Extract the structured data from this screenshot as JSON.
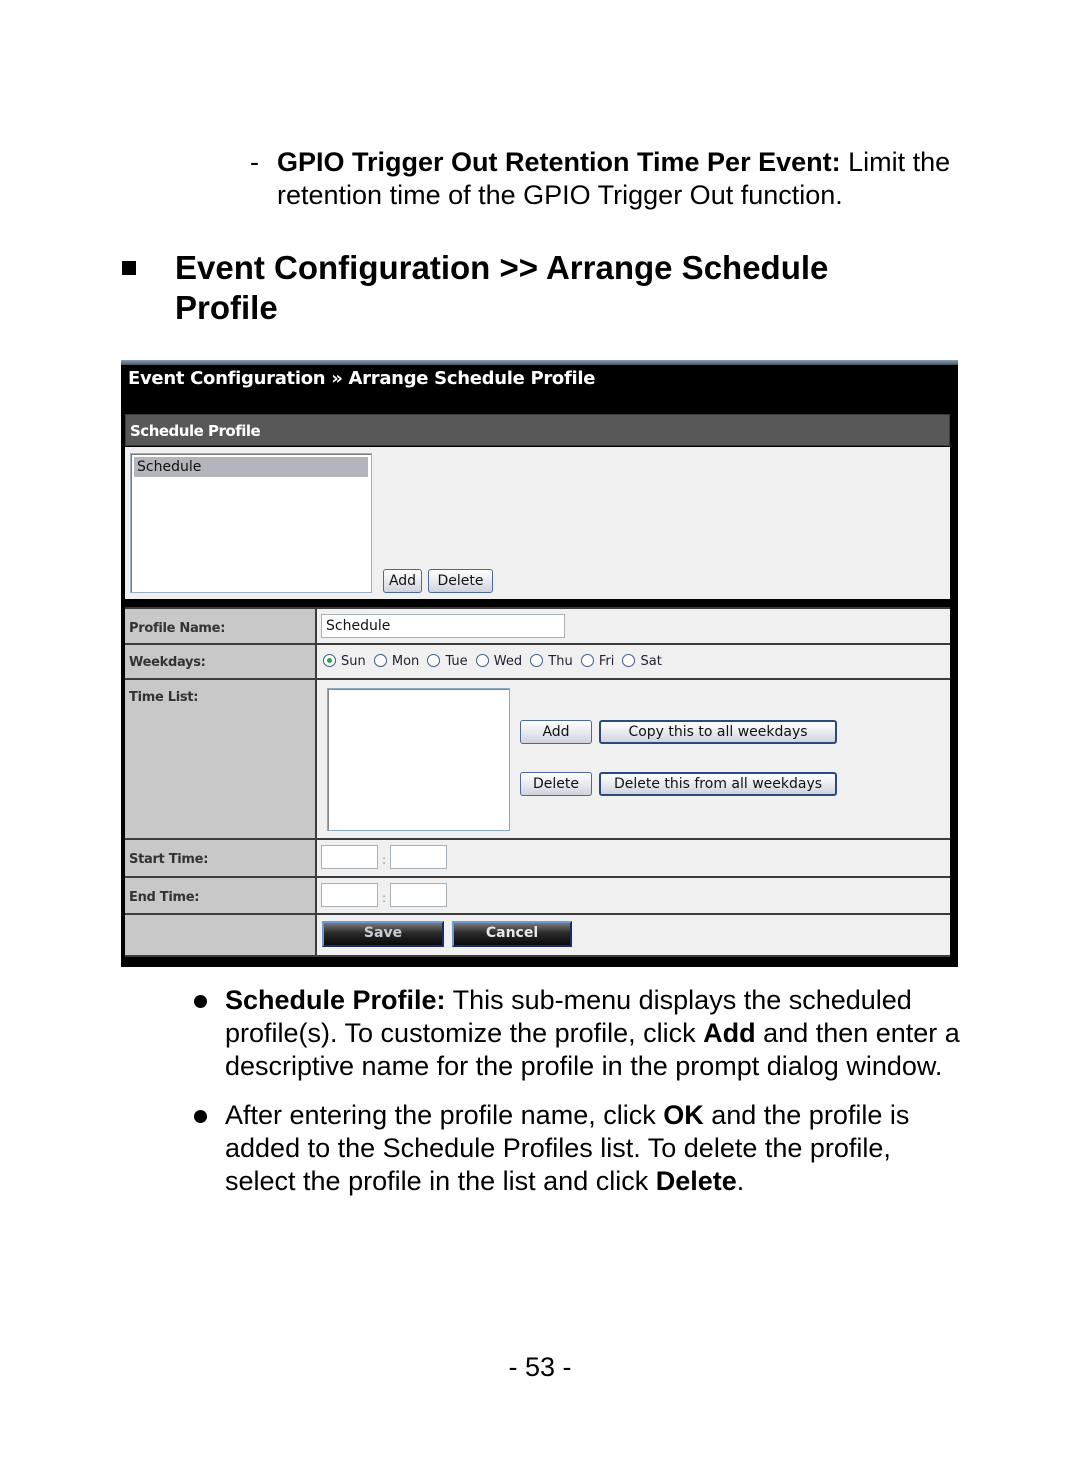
{
  "intro": {
    "dash": "-",
    "bold": "GPIO Trigger Out Retention Time Per Event:",
    "text": " Limit the retention time of the GPIO Trigger Out function."
  },
  "heading": "Event Configuration >> Arrange Schedule Profile",
  "ui": {
    "title": "Event Configuration » Arrange Schedule Profile",
    "section_title": "Schedule Profile",
    "profile_list": [
      "Schedule"
    ],
    "add_label": "Add",
    "delete_label": "Delete",
    "form": {
      "profile_name_label": "Profile Name:",
      "profile_name_value": "Schedule",
      "weekdays_label": "Weekdays:",
      "weekdays": [
        {
          "label": "Sun",
          "selected": true
        },
        {
          "label": "Mon",
          "selected": false
        },
        {
          "label": "Tue",
          "selected": false
        },
        {
          "label": "Wed",
          "selected": false
        },
        {
          "label": "Thu",
          "selected": false
        },
        {
          "label": "Fri",
          "selected": false
        },
        {
          "label": "Sat",
          "selected": false
        }
      ],
      "time_list_label": "Time List:",
      "time_add_label": "Add",
      "copy_all_label": "Copy this to all weekdays",
      "time_delete_label": "Delete",
      "delete_all_label": "Delete this from all weekdays",
      "start_time_label": "Start Time:",
      "end_time_label": "End Time:",
      "start_hour": "",
      "start_minute": "",
      "end_hour": "",
      "end_minute": "",
      "colon": ":",
      "save_label": "Save",
      "cancel_label": "Cancel"
    }
  },
  "bullets": [
    {
      "parts": [
        {
          "b": true,
          "t": "Schedule Profile:"
        },
        {
          "b": false,
          "t": " This sub-menu displays the scheduled profile(s). To customize the profile, click "
        },
        {
          "b": true,
          "t": "Add"
        },
        {
          "b": false,
          "t": " and then enter a descriptive name for the profile in the prompt dialog window."
        }
      ]
    },
    {
      "parts": [
        {
          "b": false,
          "t": "After entering the profile name, click "
        },
        {
          "b": true,
          "t": "OK"
        },
        {
          "b": false,
          "t": " and the profile is added to the Schedule Profiles list. To delete the profile, select the profile in the list and click "
        },
        {
          "b": true,
          "t": "Delete"
        },
        {
          "b": false,
          "t": "."
        }
      ]
    }
  ],
  "page_number": "- 53 -"
}
